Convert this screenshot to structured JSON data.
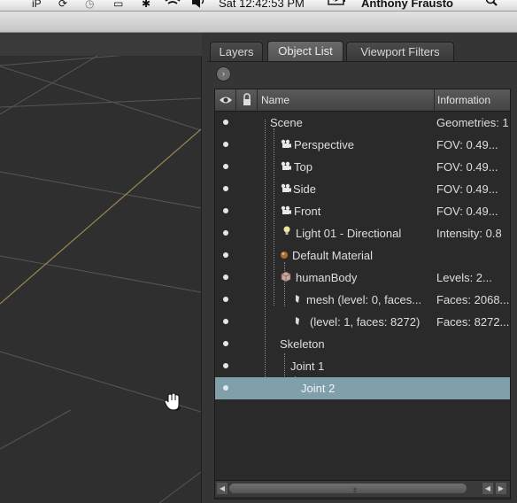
{
  "menubar": {
    "status_icons": [
      "iP",
      "⟳",
      "◷",
      "▭",
      "✱",
      "wifi",
      "🔊"
    ],
    "clock": "Sat 12:42:53 PM",
    "battery_icon": "battery-icon",
    "user": "Anthony Frausto",
    "search_icon": "🔍"
  },
  "panel": {
    "tabs": [
      {
        "label": "Layers",
        "active": false
      },
      {
        "label": "Object List",
        "active": true
      },
      {
        "label": "Viewport Filters",
        "active": false
      }
    ],
    "options_icon": "›",
    "columns": {
      "visibility_icon": "eye-icon",
      "lock_icon": "lock-icon",
      "name": "Name",
      "information": "Information"
    },
    "rows": [
      {
        "name": "Scene",
        "info": "Geometries: 1",
        "icon": "",
        "selected": false
      },
      {
        "name": "Perspective",
        "info": "FOV: 0.49...",
        "icon": "camera-icon",
        "selected": false
      },
      {
        "name": "Top",
        "info": "FOV: 0.49...",
        "icon": "camera-icon",
        "selected": false
      },
      {
        "name": "Side",
        "info": "FOV: 0.49...",
        "icon": "camera-icon",
        "selected": false
      },
      {
        "name": "Front",
        "info": "FOV: 0.49...",
        "icon": "camera-icon",
        "selected": false
      },
      {
        "name": "Light 01 - Directional",
        "info": "Intensity: 0.8",
        "icon": "light-bulb-icon",
        "selected": false
      },
      {
        "name": "Default Material",
        "info": "",
        "icon": "material-sphere-icon",
        "selected": false
      },
      {
        "name": "humanBody",
        "info": "Levels: 2...",
        "icon": "geometry-icon",
        "selected": false
      },
      {
        "name": "mesh (level: 0, faces...",
        "info": "Faces: 2068...",
        "icon": "mesh-icon",
        "selected": false
      },
      {
        "name": "(level: 1, faces: 8272)",
        "info": "Faces: 8272...",
        "icon": "mesh-icon",
        "selected": false
      },
      {
        "name": "Skeleton",
        "info": "",
        "icon": "",
        "selected": false
      },
      {
        "name": "Joint 1",
        "info": "",
        "icon": "",
        "selected": false
      },
      {
        "name": "Joint 2",
        "info": "",
        "icon": "",
        "selected": true
      }
    ],
    "scrollbar": {
      "left_icon": "◀",
      "right_icon": "▶",
      "right2_icon": "◀",
      "grip": "⦙⦙⦙⦙⦙"
    }
  },
  "colors": {
    "selection": "#7f9fab",
    "viewport_bg": "#2f2f2f",
    "grid_line": "#555555",
    "axis_line": "#9c8650"
  }
}
